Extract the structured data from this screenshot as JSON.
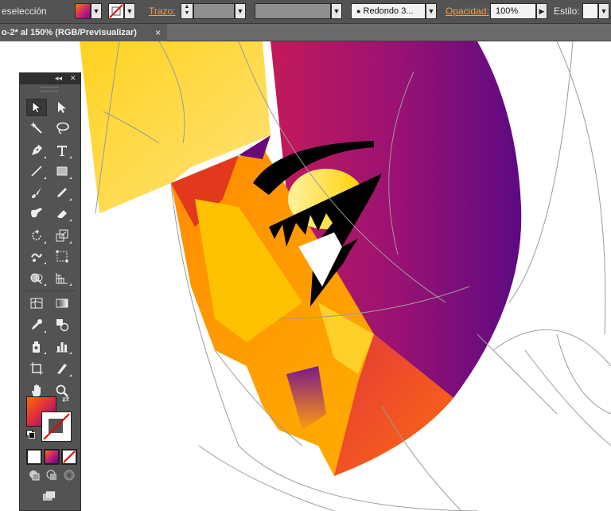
{
  "controlbar": {
    "selection_label": "eselección",
    "stroke_label": "Trazo:",
    "brush_value": "Redondo 3...",
    "opacity_label": "Opacidad:",
    "opacity_value": "100%",
    "style_label": "Estilo:"
  },
  "document_tab": {
    "title": "o-2* al 150% (RGB/Previsualizar)",
    "close": "×"
  },
  "tools_panel": {
    "collapse": "◂◂",
    "close": "✕"
  },
  "colors": {
    "panel_bg": "#535353",
    "fill_gradient_start": "#ff7a00",
    "fill_gradient_end": "#7a0a86",
    "accent_orange": "#f0a04a"
  },
  "tools": [
    {
      "icon": "selection-arrow-icon"
    },
    {
      "icon": "direct-selection-icon"
    },
    {
      "icon": "magic-wand-icon"
    },
    {
      "icon": "lasso-icon"
    },
    {
      "icon": "pen-icon"
    },
    {
      "icon": "type-icon"
    },
    {
      "icon": "line-icon"
    },
    {
      "icon": "rectangle-icon"
    },
    {
      "icon": "paintbrush-icon"
    },
    {
      "icon": "pencil-icon"
    },
    {
      "icon": "blob-brush-icon"
    },
    {
      "icon": "eraser-icon"
    },
    {
      "icon": "rotate-icon"
    },
    {
      "icon": "scale-icon"
    },
    {
      "icon": "warp-icon"
    },
    {
      "icon": "free-transform-icon"
    },
    {
      "icon": "shape-builder-icon"
    },
    {
      "icon": "perspective-grid-icon"
    },
    {
      "icon": "mesh-icon"
    },
    {
      "icon": "gradient-icon"
    },
    {
      "icon": "eyedropper-icon"
    },
    {
      "icon": "blend-icon"
    },
    {
      "icon": "symbol-sprayer-icon"
    },
    {
      "icon": "column-graph-icon"
    },
    {
      "icon": "artboard-icon"
    },
    {
      "icon": "slice-icon"
    },
    {
      "icon": "hand-icon"
    },
    {
      "icon": "zoom-icon"
    }
  ]
}
